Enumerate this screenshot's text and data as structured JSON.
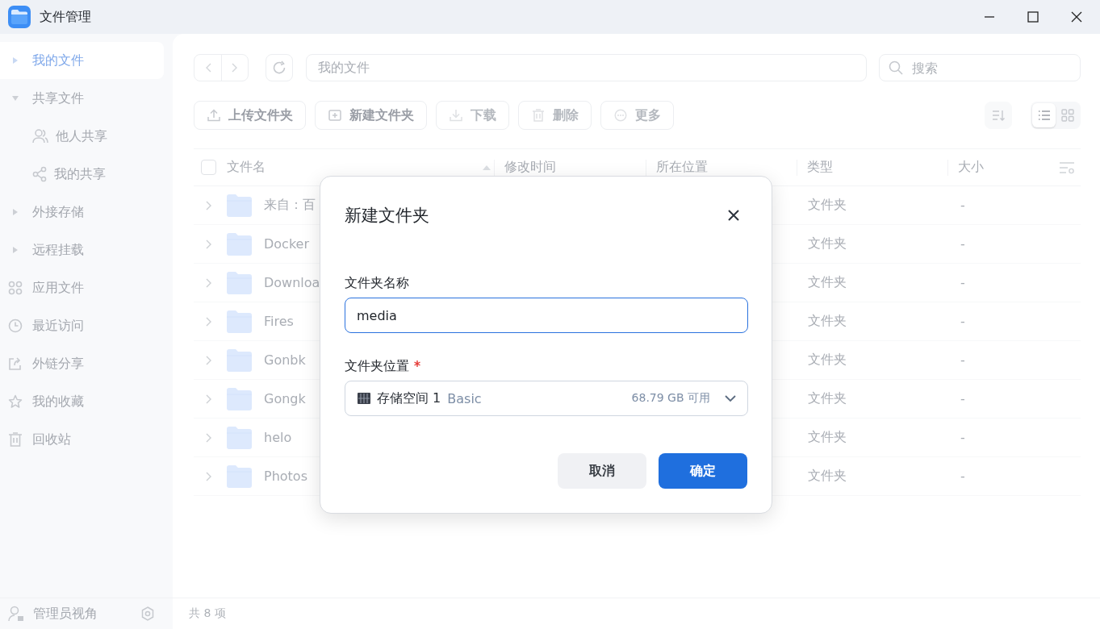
{
  "window": {
    "title": "文件管理"
  },
  "sidebar": {
    "items": [
      {
        "label": "我的文件",
        "kind": "tree",
        "expanded": false,
        "selected": true
      },
      {
        "label": "共享文件",
        "kind": "tree",
        "expanded": true,
        "selected": false,
        "children": [
          {
            "label": "他人共享",
            "selected": false
          },
          {
            "label": "我的共享",
            "selected": false
          }
        ]
      },
      {
        "label": "外接存储",
        "kind": "tree",
        "expanded": false,
        "selected": false
      },
      {
        "label": "远程挂载",
        "kind": "tree",
        "expanded": false,
        "selected": false
      },
      {
        "label": "应用文件",
        "kind": "link",
        "selected": false
      },
      {
        "label": "最近访问",
        "kind": "link",
        "selected": false
      },
      {
        "label": "外链分享",
        "kind": "link",
        "selected": false
      },
      {
        "label": "我的收藏",
        "kind": "link",
        "selected": false
      },
      {
        "label": "回收站",
        "kind": "link",
        "selected": false
      }
    ],
    "footer": {
      "label": "管理员视角"
    }
  },
  "toolbar": {
    "path": "我的文件",
    "search": {
      "placeholder": "搜索"
    }
  },
  "actions": [
    {
      "label": "上传文件夹",
      "disabled": false
    },
    {
      "label": "新建文件夹",
      "disabled": false
    },
    {
      "label": "下载",
      "disabled": true
    },
    {
      "label": "删除",
      "disabled": true
    },
    {
      "label": "更多",
      "disabled": true
    }
  ],
  "view_modes": [
    {
      "selected": true
    },
    {
      "selected": false
    }
  ],
  "table": {
    "select_all": {
      "checked": false
    },
    "columns": [
      "文件名",
      "修改时间",
      "所在位置",
      "类型",
      "大小"
    ],
    "rows": [
      {
        "name": "来自：百",
        "type": "文件夹",
        "size": "-",
        "expanded": false
      },
      {
        "name": "Docker",
        "type": "文件夹",
        "size": "-",
        "expanded": false
      },
      {
        "name": "Downloa",
        "type": "文件夹",
        "size": "-",
        "expanded": false
      },
      {
        "name": "Fires",
        "type": "文件夹",
        "size": "-",
        "expanded": false
      },
      {
        "name": "Gonbk",
        "type": "文件夹",
        "size": "-",
        "expanded": false
      },
      {
        "name": "Gongk",
        "type": "文件夹",
        "size": "-",
        "expanded": false
      },
      {
        "name": "helo",
        "type": "文件夹",
        "size": "-",
        "expanded": false
      },
      {
        "name": "Photos",
        "type": "文件夹",
        "size": "-",
        "expanded": false
      }
    ]
  },
  "status_bar": "共 8 项",
  "dialog": {
    "title": "新建文件夹",
    "fields": [
      {
        "kind": "text",
        "label": "文件夹名称",
        "value": "media",
        "focused": true
      },
      {
        "kind": "select",
        "label": "文件夹位置",
        "required": true,
        "value": "存储空间 1",
        "suffix": "Basic",
        "hint": "68.79 GB 可用",
        "focused": false
      }
    ],
    "buttons": [
      {
        "label": "取消",
        "kind": "secondary"
      },
      {
        "label": "确定",
        "kind": "primary"
      }
    ]
  }
}
